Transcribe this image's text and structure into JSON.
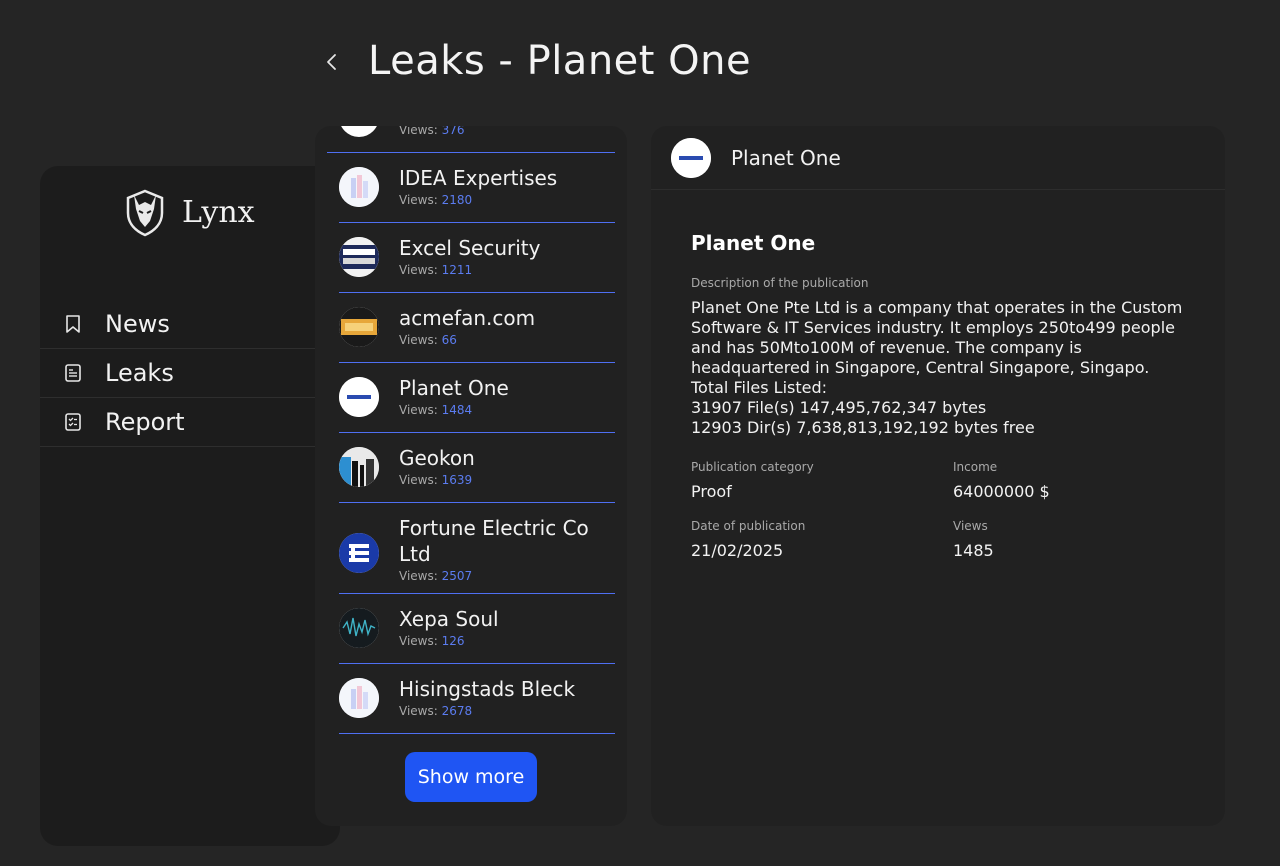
{
  "page": {
    "title": "Leaks - Planet One"
  },
  "brand": {
    "name": "Lynx"
  },
  "nav": [
    {
      "label": "News",
      "icon": "bookmark-icon"
    },
    {
      "label": "Leaks",
      "icon": "receipt-icon"
    },
    {
      "label": "Report",
      "icon": "checklist-icon"
    }
  ],
  "list": {
    "views_label": "Views:",
    "items": [
      {
        "name": "",
        "views": "376"
      },
      {
        "name": "IDEA Expertises",
        "views": "2180"
      },
      {
        "name": "Excel Security",
        "views": "1211"
      },
      {
        "name": "acmefan.com",
        "views": "66"
      },
      {
        "name": "Planet One",
        "views": "1484"
      },
      {
        "name": "Geokon",
        "views": "1639"
      },
      {
        "name": "Fortune Electric Co Ltd",
        "views": "2507"
      },
      {
        "name": "Xepa Soul",
        "views": "126"
      },
      {
        "name": "Hisingstads Bleck",
        "views": "2678"
      }
    ],
    "show_more": "Show more"
  },
  "detail": {
    "header_name": "Planet One",
    "title": "Planet One",
    "description_label": "Description of the publication",
    "description": "Planet One Pte Ltd is a company that operates in the Custom Software & IT Services industry. It employs 250to499 people and has 50Mto100M of revenue. The company is headquartered in Singapore, Central Singapore, Singapo.\nTotal Files Listed:\n31907 File(s) 147,495,762,347 bytes\n12903 Dir(s) 7,638,813,192,192 bytes free",
    "category_label": "Publication category",
    "category": "Proof",
    "income_label": "Income",
    "income": "64000000 $",
    "date_label": "Date of publication",
    "date": "21/02/2025",
    "views_label": "Views",
    "views": "1485"
  },
  "colors": {
    "accent": "#1f55f3",
    "divider": "#4f6ff2",
    "views_number": "#5b7cf0"
  }
}
